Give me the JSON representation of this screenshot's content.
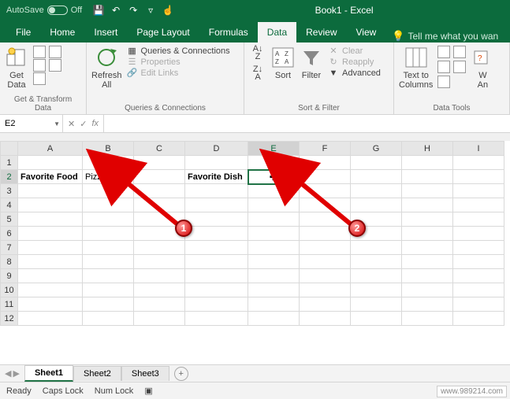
{
  "titlebar": {
    "autosave_label": "AutoSave",
    "autosave_state": "Off",
    "title": "Book1 - Excel"
  },
  "tabs": {
    "file": "File",
    "home": "Home",
    "insert": "Insert",
    "page_layout": "Page Layout",
    "formulas": "Formulas",
    "data": "Data",
    "review": "Review",
    "view": "View",
    "tell_me": "Tell me what you wan"
  },
  "ribbon": {
    "get_transform": {
      "label": "Get & Transform Data",
      "get_data": "Get\nData"
    },
    "queries": {
      "label": "Queries & Connections",
      "refresh": "Refresh\nAll",
      "queries_conn": "Queries & Connections",
      "properties": "Properties",
      "edit_links": "Edit Links"
    },
    "sort_filter": {
      "label": "Sort & Filter",
      "sort": "Sort",
      "filter": "Filter",
      "clear": "Clear",
      "reapply": "Reapply",
      "advanced": "Advanced"
    },
    "data_tools": {
      "label": "Data Tools",
      "text_to_columns": "Text to\nColumns",
      "what_if": "W\nAn"
    }
  },
  "formula_bar": {
    "name_box": "E2",
    "fx": "fx",
    "value": ""
  },
  "columns": [
    "A",
    "B",
    "C",
    "D",
    "E",
    "F",
    "G",
    "H",
    "I"
  ],
  "rows": [
    "1",
    "2",
    "3",
    "4",
    "5",
    "6",
    "7",
    "8",
    "9",
    "10",
    "11",
    "12"
  ],
  "cells": {
    "A2": "Favorite Food",
    "B2": "Pizza",
    "D2": "Favorite Dish"
  },
  "active_cell": "E2",
  "sheets": {
    "s1": "Sheet1",
    "s2": "Sheet2",
    "s3": "Sheet3"
  },
  "status": {
    "ready": "Ready",
    "caps": "Caps Lock",
    "num": "Num Lock"
  },
  "annotations": {
    "one": "1",
    "two": "2"
  },
  "watermark": "www.989214.com"
}
